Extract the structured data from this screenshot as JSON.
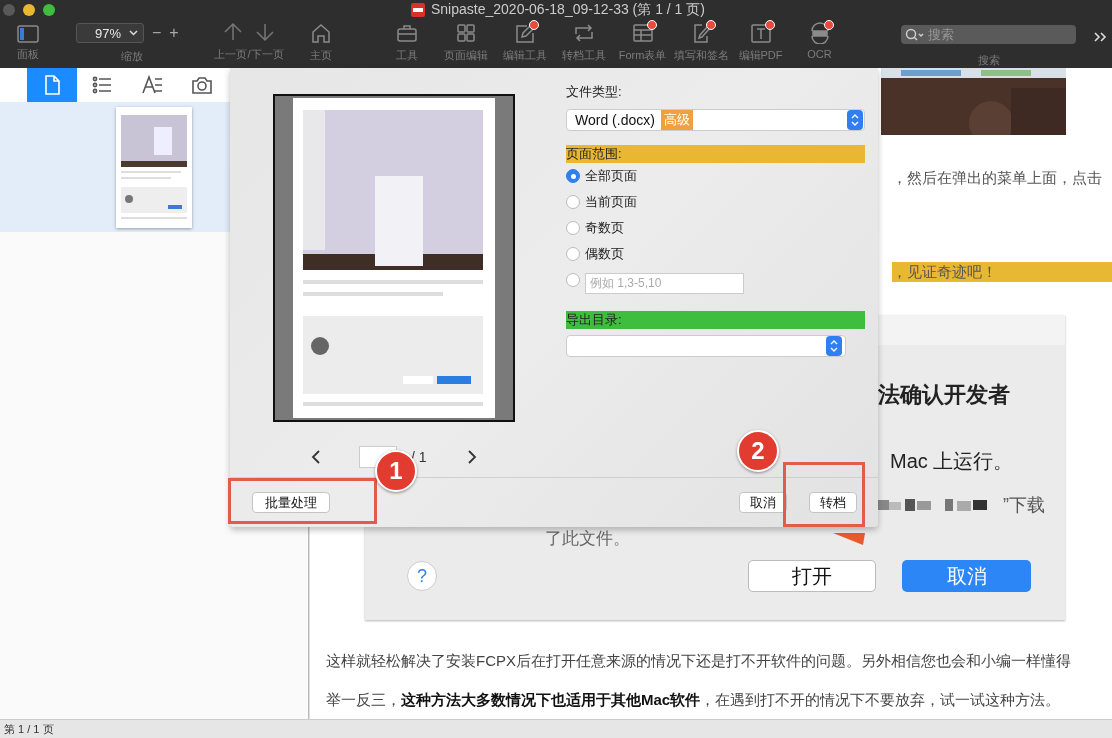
{
  "window": {
    "title": "Snipaste_2020-06-18_09-12-33 (第 1 / 1 页)"
  },
  "toolbar": {
    "panel_label": "面板",
    "zoom": {
      "value": "97%",
      "label": "缩放",
      "minus": "−",
      "plus": "+"
    },
    "nav_label": "上一页/下一页",
    "tools": [
      {
        "kind": "home",
        "label": "主页",
        "dot": false
      },
      {
        "kind": "toolbox",
        "label": "工具",
        "dot": false
      },
      {
        "kind": "grid",
        "label": "页面编辑",
        "dot": false
      },
      {
        "kind": "edit",
        "label": "编辑工具",
        "dot": true
      },
      {
        "kind": "convert",
        "label": "转档工具",
        "dot": false
      },
      {
        "kind": "form",
        "label": "Form表单",
        "dot": true
      },
      {
        "kind": "sign",
        "label": "填写和签名",
        "dot": true
      },
      {
        "kind": "text",
        "label": "编辑PDF",
        "dot": true
      },
      {
        "kind": "ocr",
        "label": "OCR",
        "dot": true
      }
    ],
    "search": {
      "placeholder": "搜索",
      "label": "搜索"
    }
  },
  "sidebar": {
    "tabs": [
      {
        "kind": "page",
        "selected": true
      },
      {
        "kind": "list",
        "selected": false
      },
      {
        "kind": "font",
        "selected": false
      },
      {
        "kind": "camera",
        "selected": false
      }
    ],
    "thumbnails": [
      {
        "selected": true
      }
    ]
  },
  "document": {
    "line_1": "，然后在弹出的菜单上面，点击",
    "line_2": "，见证奇迹吧！",
    "embedded_dialog": {
      "title": "法确认开发者",
      "message": "Mac 上运行。",
      "source": "”下载",
      "note": "了此文件。",
      "help": "?",
      "open_button": "打开",
      "cancel_button": "取消"
    },
    "paragraph": [
      "这样就轻松解决了安装FCPX后在打开任意来源的情况下还是打不开软件的问题。另外相信您也会和小编一样懂得",
      "举一反三，**这种方法大多数情况下也适用于其他Mac软件**，在遇到打不开的情况下不要放弃，试一试这种方法。"
    ]
  },
  "dialog": {
    "page_total": "/ 1",
    "file_type_label": "文件类型:",
    "file_type": "Word (.docx)",
    "file_type_tag": "高级",
    "range_label": "页面范围:",
    "ranges": [
      {
        "kind": "option",
        "label": "全部页面",
        "selected": true
      },
      {
        "kind": "option",
        "label": "当前页面",
        "selected": false
      },
      {
        "kind": "option",
        "label": "奇数页",
        "selected": false
      },
      {
        "kind": "option",
        "label": "偶数页",
        "selected": false
      },
      {
        "kind": "custom",
        "placeholder": "例如 1,3-5,10",
        "selected": false
      }
    ],
    "export_label": "导出目录:",
    "batch_button": "批量处理",
    "cancel_button": "取消",
    "convert_button": "转档"
  },
  "annotations": [
    {
      "number": "1"
    },
    {
      "number": "2"
    }
  ],
  "status_bar": "第 1 / 1 页"
}
